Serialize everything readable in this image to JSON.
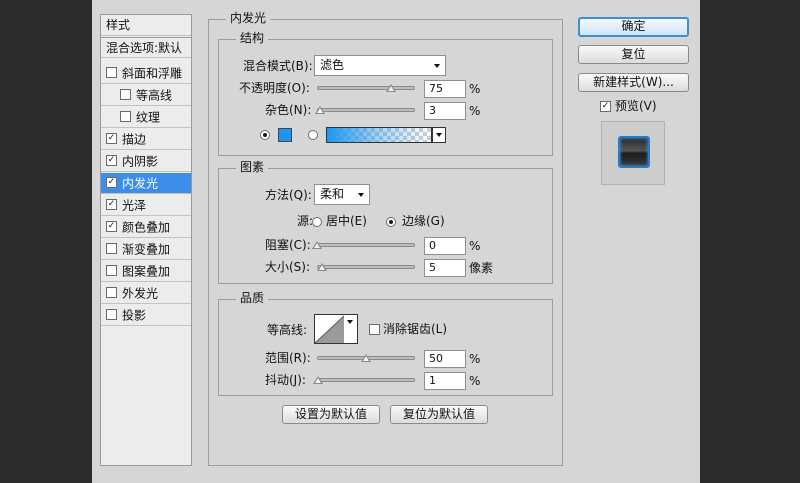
{
  "styles_panel": {
    "header": "样式",
    "blend_options": "混合选项:默认",
    "items": [
      {
        "label": "斜面和浮雕",
        "checked": false,
        "indent": false,
        "selected": false
      },
      {
        "label": "等高线",
        "checked": false,
        "indent": true,
        "selected": false
      },
      {
        "label": "纹理",
        "checked": false,
        "indent": true,
        "selected": false
      },
      {
        "label": "描边",
        "checked": true,
        "indent": false,
        "selected": false
      },
      {
        "label": "内阴影",
        "checked": true,
        "indent": false,
        "selected": false
      },
      {
        "label": "内发光",
        "checked": true,
        "indent": false,
        "selected": true
      },
      {
        "label": "光泽",
        "checked": true,
        "indent": false,
        "selected": false
      },
      {
        "label": "颜色叠加",
        "checked": true,
        "indent": false,
        "selected": false
      },
      {
        "label": "渐变叠加",
        "checked": false,
        "indent": false,
        "selected": false
      },
      {
        "label": "图案叠加",
        "checked": false,
        "indent": false,
        "selected": false
      },
      {
        "label": "外发光",
        "checked": false,
        "indent": false,
        "selected": false
      },
      {
        "label": "投影",
        "checked": false,
        "indent": false,
        "selected": false
      }
    ]
  },
  "inner_glow": {
    "title": "内发光",
    "structure": {
      "legend": "结构",
      "blend_mode_label": "混合模式(B):",
      "blend_mode_value": "滤色",
      "opacity_label": "不透明度(O):",
      "opacity_value": "75",
      "opacity_percent": 75,
      "noise_label": "杂色(N):",
      "noise_value": "3",
      "noise_percent": 3,
      "percent_sign": "%",
      "color": "#1e96f0"
    },
    "elements": {
      "legend": "图素",
      "technique_label": "方法(Q):",
      "technique_value": "柔和",
      "source_label": "源:",
      "source_center": "居中(E)",
      "source_edge": "边缘(G)",
      "choke_label": "阻塞(C):",
      "choke_value": "0",
      "choke_percent": 0,
      "size_label": "大小(S):",
      "size_value": "5",
      "size_unit": "像素",
      "percent_sign": "%"
    },
    "quality": {
      "legend": "品质",
      "contour_label": "等高线:",
      "antialias_label": "消除锯齿(L)",
      "range_label": "范围(R):",
      "range_value": "50",
      "range_percent": 50,
      "jitter_label": "抖动(J):",
      "jitter_value": "1",
      "jitter_percent": 1,
      "percent_sign": "%"
    },
    "make_default": "设置为默认值",
    "reset_default": "复位为默认值"
  },
  "buttons": {
    "ok": "确定",
    "reset": "复位",
    "new_style": "新建样式(W)...",
    "preview_label": "预览(V)",
    "preview_checked": true
  }
}
